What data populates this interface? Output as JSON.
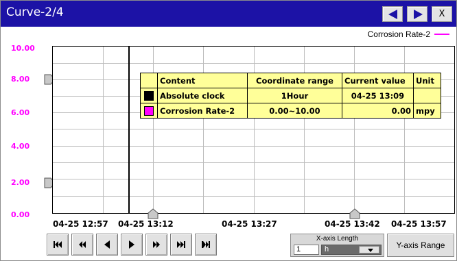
{
  "window": {
    "title": "Curve-2/4",
    "close_label": "X",
    "prev_icon": "prev-page-icon",
    "next_icon": "next-page-icon"
  },
  "legend": {
    "label": "Corrosion Rate-2",
    "color": "#ff00ff"
  },
  "y_axis": {
    "ticks": [
      "10.00",
      "8.00",
      "6.00",
      "4.00",
      "2.00",
      "0.00"
    ],
    "color": "#ff00ff"
  },
  "x_axis": {
    "ticks": [
      "04-25 12:57",
      "04-25 13:12",
      "04-25 13:27",
      "04-25 13:42",
      "04-25 13:57"
    ]
  },
  "info_table": {
    "headers": [
      "Content",
      "Coordinate range",
      "Current value",
      "Unit"
    ],
    "rows": [
      {
        "color": "#000000",
        "content": "Absolute clock",
        "range": "1Hour",
        "value": "04-25 13:09",
        "unit": ""
      },
      {
        "color": "#ff00ff",
        "content": "Corrosion Rate-2",
        "range": "0.00~10.00",
        "value": "0.00",
        "unit": "mpy"
      }
    ],
    "background": "#ffff99"
  },
  "nav_buttons": [
    {
      "name": "first-page-button",
      "icon": "skip-to-start-icon"
    },
    {
      "name": "fast-back-button",
      "icon": "rewind-icon"
    },
    {
      "name": "step-back-button",
      "icon": "step-back-icon"
    },
    {
      "name": "step-forward-button",
      "icon": "step-forward-icon"
    },
    {
      "name": "fast-forward-button",
      "icon": "fast-forward-icon"
    },
    {
      "name": "last-page-button",
      "icon": "skip-to-end-icon"
    },
    {
      "name": "current-button",
      "icon": "jump-to-current-icon"
    }
  ],
  "x_axis_length": {
    "label": "X-axis Length",
    "value": "1",
    "unit": "h"
  },
  "y_range_label": "Y-axis Range",
  "colors": {
    "title_bar": "#1c12a6",
    "accent": "#ff00ff"
  }
}
